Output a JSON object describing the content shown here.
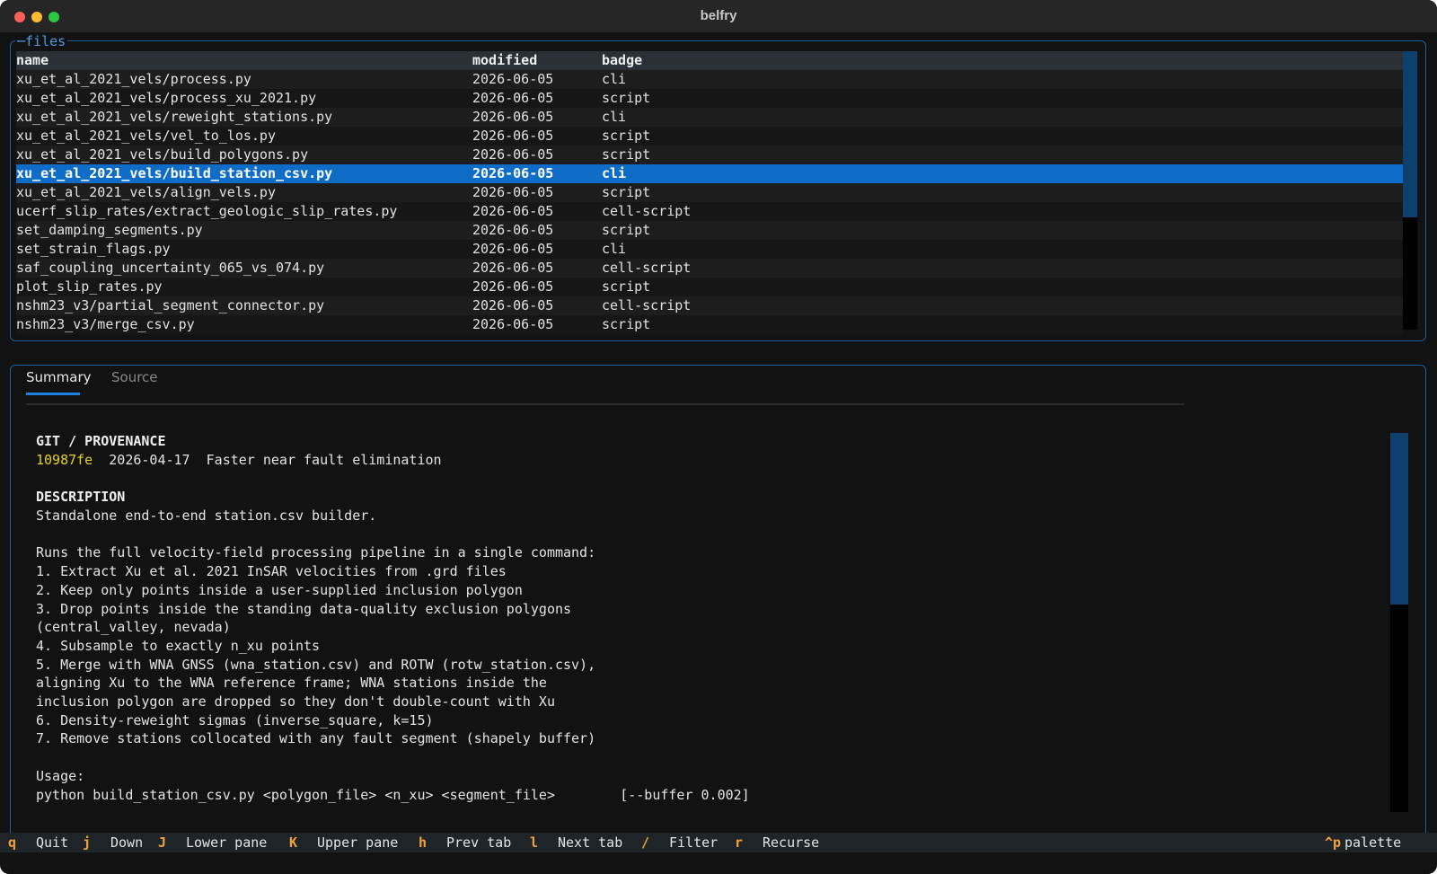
{
  "window": {
    "title": "belfry"
  },
  "files": {
    "legend": "files",
    "headers": {
      "name": "name",
      "modified": "modified",
      "badge": "badge"
    },
    "rows": [
      {
        "name": "xu_et_al_2021_vels/process.py",
        "modified": "2026-06-05",
        "badge": "cli"
      },
      {
        "name": "xu_et_al_2021_vels/process_xu_2021.py",
        "modified": "2026-06-05",
        "badge": "script"
      },
      {
        "name": "xu_et_al_2021_vels/reweight_stations.py",
        "modified": "2026-06-05",
        "badge": "cli"
      },
      {
        "name": "xu_et_al_2021_vels/vel_to_los.py",
        "modified": "2026-06-05",
        "badge": "script"
      },
      {
        "name": "xu_et_al_2021_vels/build_polygons.py",
        "modified": "2026-06-05",
        "badge": "script"
      },
      {
        "name": "xu_et_al_2021_vels/build_station_csv.py",
        "modified": "2026-06-05",
        "badge": "cli"
      },
      {
        "name": "xu_et_al_2021_vels/align_vels.py",
        "modified": "2026-06-05",
        "badge": "script"
      },
      {
        "name": "ucerf_slip_rates/extract_geologic_slip_rates.py",
        "modified": "2026-06-05",
        "badge": "cell-script"
      },
      {
        "name": "set_damping_segments.py",
        "modified": "2026-06-05",
        "badge": "script"
      },
      {
        "name": "set_strain_flags.py",
        "modified": "2026-06-05",
        "badge": "cli"
      },
      {
        "name": "saf_coupling_uncertainty_065_vs_074.py",
        "modified": "2026-06-05",
        "badge": "cell-script"
      },
      {
        "name": "plot_slip_rates.py",
        "modified": "2026-06-05",
        "badge": "script"
      },
      {
        "name": "nshm23_v3/partial_segment_connector.py",
        "modified": "2026-06-05",
        "badge": "cell-script"
      },
      {
        "name": "nshm23_v3/merge_csv.py",
        "modified": "2026-06-05",
        "badge": "script"
      }
    ],
    "selected_index": 5
  },
  "tabs": {
    "summary": "Summary",
    "source": "Source",
    "active": "Summary"
  },
  "summary": {
    "git_heading": "GIT / PROVENANCE",
    "commit_hash": "10987fe",
    "commit_date": "2026-04-17",
    "commit_message": "Faster near fault elimination",
    "description_heading": "DESCRIPTION",
    "lines": [
      "Standalone end-to-end station.csv builder.",
      "",
      "Runs the full velocity-field processing pipeline in a single command:",
      "1. Extract Xu et al. 2021 InSAR velocities from .grd files",
      "2. Keep only points inside a user-supplied inclusion polygon",
      "3. Drop points inside the standing data-quality exclusion polygons",
      "(central_valley, nevada)",
      "4. Subsample to exactly n_xu points",
      "5. Merge with WNA GNSS (wna_station.csv) and ROTW (rotw_station.csv),",
      "aligning Xu to the WNA reference frame; WNA stations inside the",
      "inclusion polygon are dropped so they don't double-count with Xu",
      "6. Density-reweight sigmas (inverse_square, k=15)",
      "7. Remove stations collocated with any fault segment (shapely buffer)",
      "",
      "Usage:",
      "python build_station_csv.py <polygon_file> <n_xu> <segment_file>        [--buffer 0.002]"
    ]
  },
  "footer": {
    "bindings": [
      {
        "key": "q",
        "label": "Quit"
      },
      {
        "key": "j",
        "label": "Down"
      },
      {
        "key": "J",
        "label": "Lower pane"
      },
      {
        "key": "K",
        "label": "Upper pane"
      },
      {
        "key": "h",
        "label": "Prev tab"
      },
      {
        "key": "l",
        "label": "Next tab"
      },
      {
        "key": "/",
        "label": "Filter"
      },
      {
        "key": "r",
        "label": "Recurse"
      }
    ],
    "palette_key": "^p",
    "palette_label": "palette"
  },
  "colors": {
    "accent": "#0f6dc8",
    "border": "#1b5fa0",
    "key": "#f2a33c",
    "hash": "#e8d21a"
  }
}
